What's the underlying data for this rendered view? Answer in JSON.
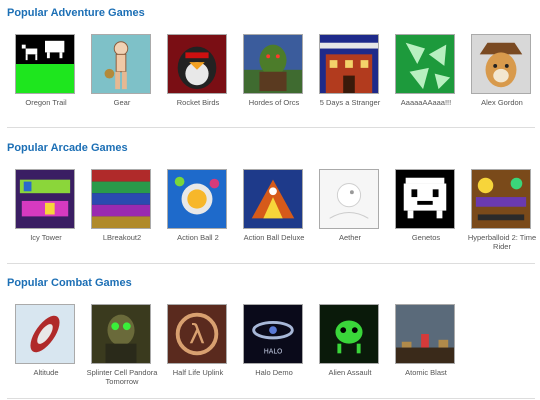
{
  "sections": [
    {
      "title": "Popular Adventure Games",
      "games": [
        {
          "label": "Oregon Trail",
          "icon": "oregon-trail-thumbnail"
        },
        {
          "label": "Gear",
          "icon": "gear-thumbnail"
        },
        {
          "label": "Rocket Birds",
          "icon": "rocket-birds-thumbnail"
        },
        {
          "label": "Hordes of Orcs",
          "icon": "hordes-of-orcs-thumbnail"
        },
        {
          "label": "5 Days a Stranger",
          "icon": "five-days-a-stranger-thumbnail"
        },
        {
          "label": "AaaaaAAaaa!!!",
          "icon": "aaaaaaaaaa-thumbnail"
        },
        {
          "label": "Alex Gordon",
          "icon": "alex-gordon-thumbnail"
        }
      ]
    },
    {
      "title": "Popular Arcade Games",
      "games": [
        {
          "label": "Icy Tower",
          "icon": "icy-tower-thumbnail"
        },
        {
          "label": "LBreakout2",
          "icon": "lbreakout2-thumbnail"
        },
        {
          "label": "Action Ball 2",
          "icon": "action-ball-2-thumbnail"
        },
        {
          "label": "Action Ball Deluxe",
          "icon": "action-ball-deluxe-thumbnail"
        },
        {
          "label": "Aether",
          "icon": "aether-thumbnail"
        },
        {
          "label": "Genetos",
          "icon": "genetos-thumbnail"
        },
        {
          "label": "Hyperballoid 2: Time Rider",
          "icon": "hyperballoid-2-thumbnail"
        }
      ]
    },
    {
      "title": "Popular Combat Games",
      "games": [
        {
          "label": "Altitude",
          "icon": "altitude-thumbnail"
        },
        {
          "label": "Splinter Cell Pandora Tomorrow",
          "icon": "splinter-cell-thumbnail"
        },
        {
          "label": "Half Life Uplink",
          "icon": "half-life-uplink-thumbnail"
        },
        {
          "label": "Halo Demo",
          "icon": "halo-demo-thumbnail"
        },
        {
          "label": "Alien Assault",
          "icon": "alien-assault-thumbnail"
        },
        {
          "label": "Atomic Blast",
          "icon": "atomic-blast-thumbnail"
        }
      ]
    }
  ],
  "colors": {
    "section_title": "#1c6fb5",
    "label": "#555555",
    "divider": "#dddddd"
  }
}
